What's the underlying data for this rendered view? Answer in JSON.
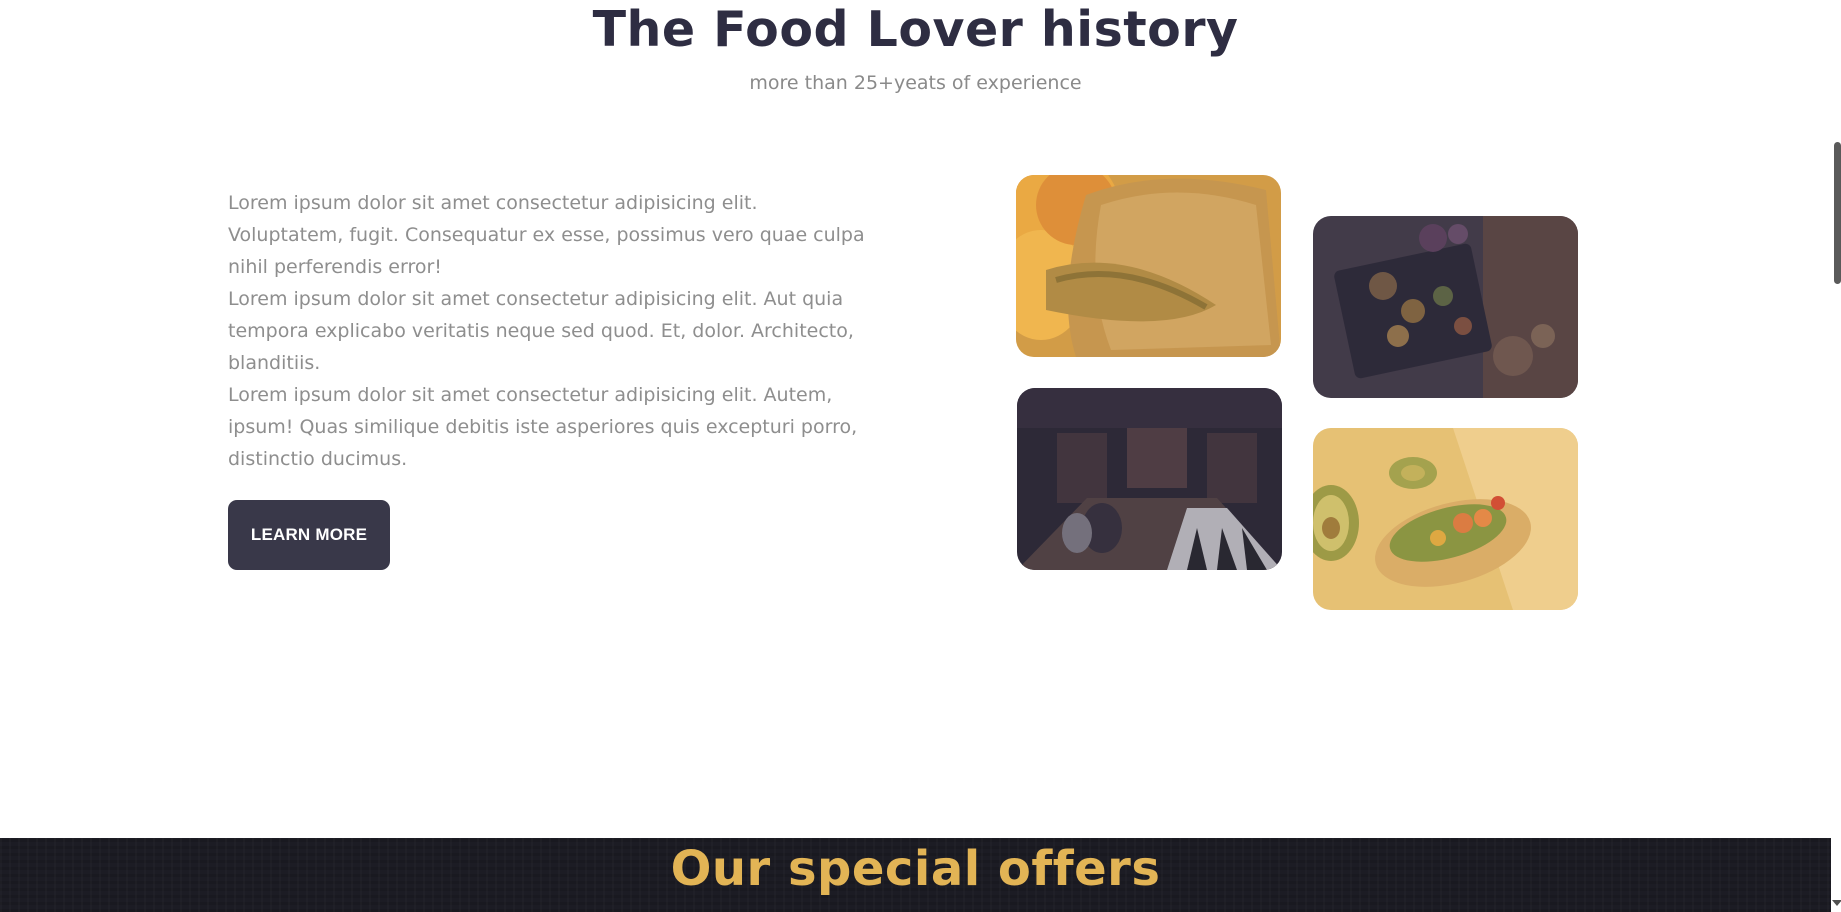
{
  "history": {
    "title": "The Food Lover history",
    "subtitle": "more than 25+yeats of experience",
    "paragraphs": [
      "Lorem ipsum dolor sit amet consectetur adipisicing elit. Voluptatem, fugit. Consequatur ex esse, possimus vero quae culpa nihil perferendis error!",
      "Lorem ipsum dolor sit amet consectetur adipisicing elit. Aut quia tempora explicabo veritatis neque sed quod. Et, dolor. Architecto, blanditiis.",
      "Lorem ipsum dolor sit amet consectetur adipisicing elit. Autem, ipsum! Quas similique debitis iste asperiores quis excepturi porro, distinctio ducimus."
    ],
    "button_label": "LEARN MORE"
  },
  "gallery": {
    "images": [
      {
        "subject": "roast-meat-image"
      },
      {
        "subject": "food-platter-image"
      },
      {
        "subject": "restaurant-interior-image"
      },
      {
        "subject": "avocado-toast-image"
      }
    ]
  },
  "offers": {
    "title": "Our special offers"
  },
  "colors": {
    "heading": "#2e2d42",
    "muted_text": "#8e8e8e",
    "button_bg": "#393849",
    "accent_gold": "#e2b455",
    "dark_band": "#1c1c24"
  }
}
